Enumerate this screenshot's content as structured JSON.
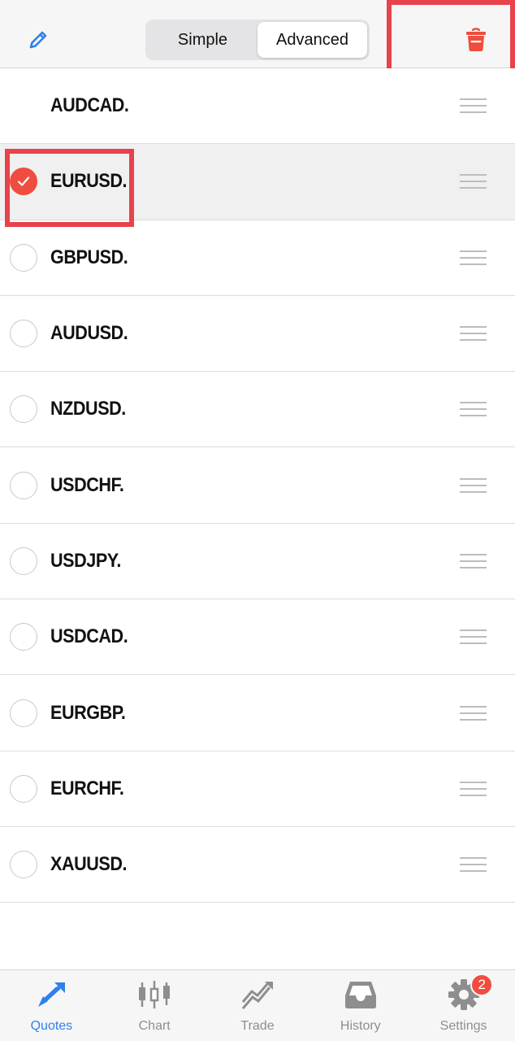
{
  "header": {
    "edit_icon": "pencil-icon",
    "segments": [
      {
        "label": "Simple",
        "active": false
      },
      {
        "label": "Advanced",
        "active": true
      }
    ],
    "delete_icon": "trash-icon"
  },
  "colors": {
    "accent": "#2f80ed",
    "danger": "#ef4d40",
    "highlight_box": "#e8424c"
  },
  "symbols": [
    {
      "name": "AUDCAD.",
      "selected": false,
      "show_radio": false
    },
    {
      "name": "EURUSD.",
      "selected": true,
      "show_radio": true
    },
    {
      "name": "GBPUSD.",
      "selected": false,
      "show_radio": true
    },
    {
      "name": "AUDUSD.",
      "selected": false,
      "show_radio": true
    },
    {
      "name": "NZDUSD.",
      "selected": false,
      "show_radio": true
    },
    {
      "name": "USDCHF.",
      "selected": false,
      "show_radio": true
    },
    {
      "name": "USDJPY.",
      "selected": false,
      "show_radio": true
    },
    {
      "name": "USDCAD.",
      "selected": false,
      "show_radio": true
    },
    {
      "name": "EURGBP.",
      "selected": false,
      "show_radio": true
    },
    {
      "name": "EURCHF.",
      "selected": false,
      "show_radio": true
    },
    {
      "name": "XAUUSD.",
      "selected": false,
      "show_radio": true
    }
  ],
  "tabbar": {
    "tabs": [
      {
        "label": "Quotes",
        "icon": "quotes-arrows-icon",
        "active": true
      },
      {
        "label": "Chart",
        "icon": "candlestick-icon",
        "active": false
      },
      {
        "label": "Trade",
        "icon": "trend-line-icon",
        "active": false
      },
      {
        "label": "History",
        "icon": "inbox-icon",
        "active": false
      },
      {
        "label": "Settings",
        "icon": "gear-icon",
        "active": false,
        "badge": "2"
      }
    ]
  }
}
